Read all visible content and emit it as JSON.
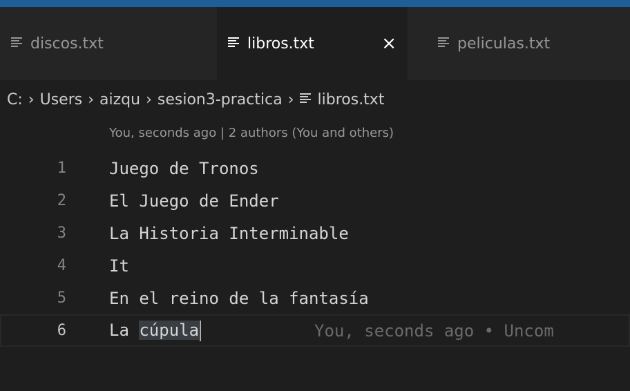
{
  "tabs": [
    {
      "label": "discos.txt",
      "active": false
    },
    {
      "label": "libros.txt",
      "active": true,
      "close_icon": "×"
    },
    {
      "label": "peliculas.txt",
      "active": false
    }
  ],
  "breadcrumb": {
    "drive": "C:",
    "users": "Users",
    "user": "aizqu",
    "folder": "sesion3-practica",
    "file": "libros.txt",
    "separator": "›"
  },
  "codelens": "You, seconds ago | 2 authors (You and others)",
  "lines": [
    {
      "number": "1",
      "text": "Juego de Tronos"
    },
    {
      "number": "2",
      "text": "El Juego de Ender"
    },
    {
      "number": "3",
      "text": "La Historia Interminable"
    },
    {
      "number": "4",
      "text": "It"
    },
    {
      "number": "5",
      "text": "En el reino de la fantasía"
    },
    {
      "number": "6",
      "text_prefix": "La ",
      "text_selected": "cúpula"
    }
  ],
  "blame": "You, seconds ago • Uncom",
  "colors": {
    "titlebar": "#1f5f99",
    "tabbar": "#252526",
    "editor_bg": "#1e1e1e",
    "selection": "#3a3d41"
  }
}
